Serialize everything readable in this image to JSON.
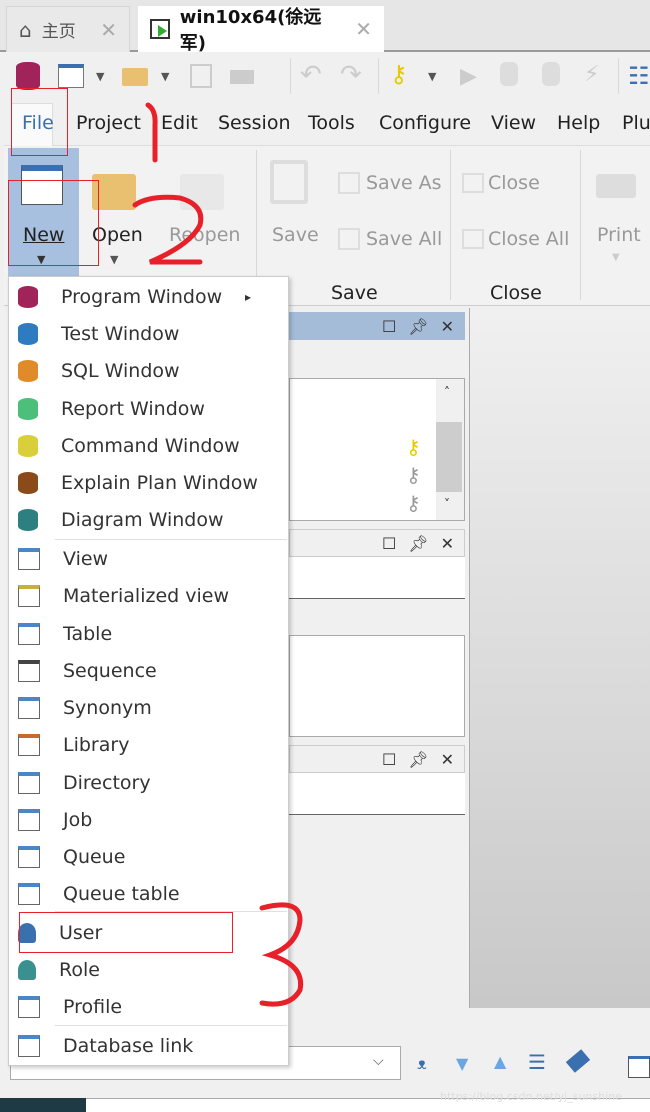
{
  "tabs": [
    {
      "label": "主页",
      "icon": "home-icon"
    },
    {
      "label": "win10x64(徐远军)",
      "icon": "session-window-icon"
    }
  ],
  "menubar": [
    "File",
    "Project",
    "Edit",
    "Session",
    "Tools",
    "Configure",
    "View",
    "Help",
    "Plu"
  ],
  "ribbon": {
    "new": "New",
    "open": "Open",
    "reopen": "Reopen",
    "save": "Save",
    "save_as": "Save As",
    "save_all": "Save All",
    "close": "Close",
    "close_all": "Close All",
    "print": "Print",
    "group_save": "Save",
    "group_close": "Close"
  },
  "new_menu": [
    {
      "label": "Program Window",
      "icon": "program-window-icon",
      "color": "#a0245a",
      "submenu": true
    },
    {
      "label": "Test Window",
      "icon": "test-window-icon",
      "color": "#2e7bbf"
    },
    {
      "label": "SQL Window",
      "icon": "sql-window-icon",
      "color": "#e08a2a"
    },
    {
      "label": "Report Window",
      "icon": "report-window-icon",
      "color": "#4cbf7a"
    },
    {
      "label": "Command Window",
      "icon": "command-window-icon",
      "color": "#d8cf3a"
    },
    {
      "label": "Explain Plan Window",
      "icon": "explain-plan-icon",
      "color": "#8a4a1a"
    },
    {
      "label": "Diagram Window",
      "icon": "diagram-window-icon",
      "color": "#2e7f7f"
    },
    {
      "label": "View",
      "icon": "view-icon",
      "color": "#4a86c8"
    },
    {
      "label": "Materialized view",
      "icon": "materialized-view-icon",
      "color": "#c8b040"
    },
    {
      "label": "Table",
      "icon": "table-icon",
      "color": "#4a86c8"
    },
    {
      "label": "Sequence",
      "icon": "sequence-icon",
      "color": "#444"
    },
    {
      "label": "Synonym",
      "icon": "synonym-icon",
      "color": "#4a86c8"
    },
    {
      "label": "Library",
      "icon": "library-icon",
      "color": "#c86a2a"
    },
    {
      "label": "Directory",
      "icon": "directory-icon",
      "color": "#4a86c8"
    },
    {
      "label": "Job",
      "icon": "job-icon",
      "color": "#4a86c8"
    },
    {
      "label": "Queue",
      "icon": "queue-icon",
      "color": "#4a86c8"
    },
    {
      "label": "Queue table",
      "icon": "queue-table-icon",
      "color": "#4a86c8"
    },
    {
      "label": "User",
      "icon": "user-icon",
      "color": "#3a6fb0"
    },
    {
      "label": "Role",
      "icon": "role-icon",
      "color": "#3a8f8f"
    },
    {
      "label": "Profile",
      "icon": "profile-icon",
      "color": "#4a86c8"
    },
    {
      "label": "Database link",
      "icon": "database-link-icon",
      "color": "#4a86c8"
    }
  ],
  "annotations": [
    "1",
    "2",
    "3"
  ],
  "annotation_color": "#e8202a",
  "watermark": "https://blog.csdn.net/yj_sunshine"
}
